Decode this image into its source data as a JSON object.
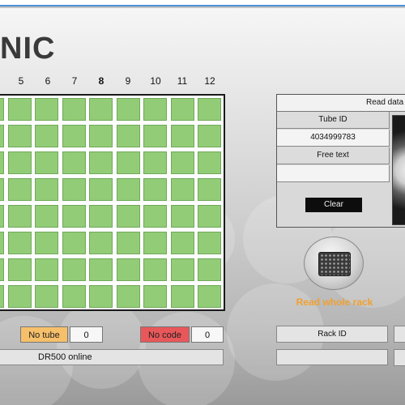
{
  "brand": {
    "text": "NIC"
  },
  "columns": [
    "5",
    "6",
    "7",
    "8",
    "9",
    "10",
    "11",
    "12"
  ],
  "plate": {
    "rows": 8,
    "visible_columns": 8,
    "well_color": "#92cc76"
  },
  "counters": {
    "no_tube": {
      "label": "No tube",
      "count": "0",
      "color": "#f6c06a"
    },
    "no_code": {
      "label": "No code",
      "count": "0",
      "color": "#e8575a"
    }
  },
  "status": {
    "text": "DR500 online"
  },
  "read_panel": {
    "header": "Read data D",
    "tube_id_label": "Tube ID",
    "tube_id_value": "4034999783",
    "free_text_label": "Free text",
    "free_text_value": "",
    "clear_label": "Clear"
  },
  "read_whole_rack": {
    "label": "Read whole rack",
    "icon": "rack-icon"
  },
  "rack_id": {
    "label": "Rack ID",
    "value": ""
  }
}
